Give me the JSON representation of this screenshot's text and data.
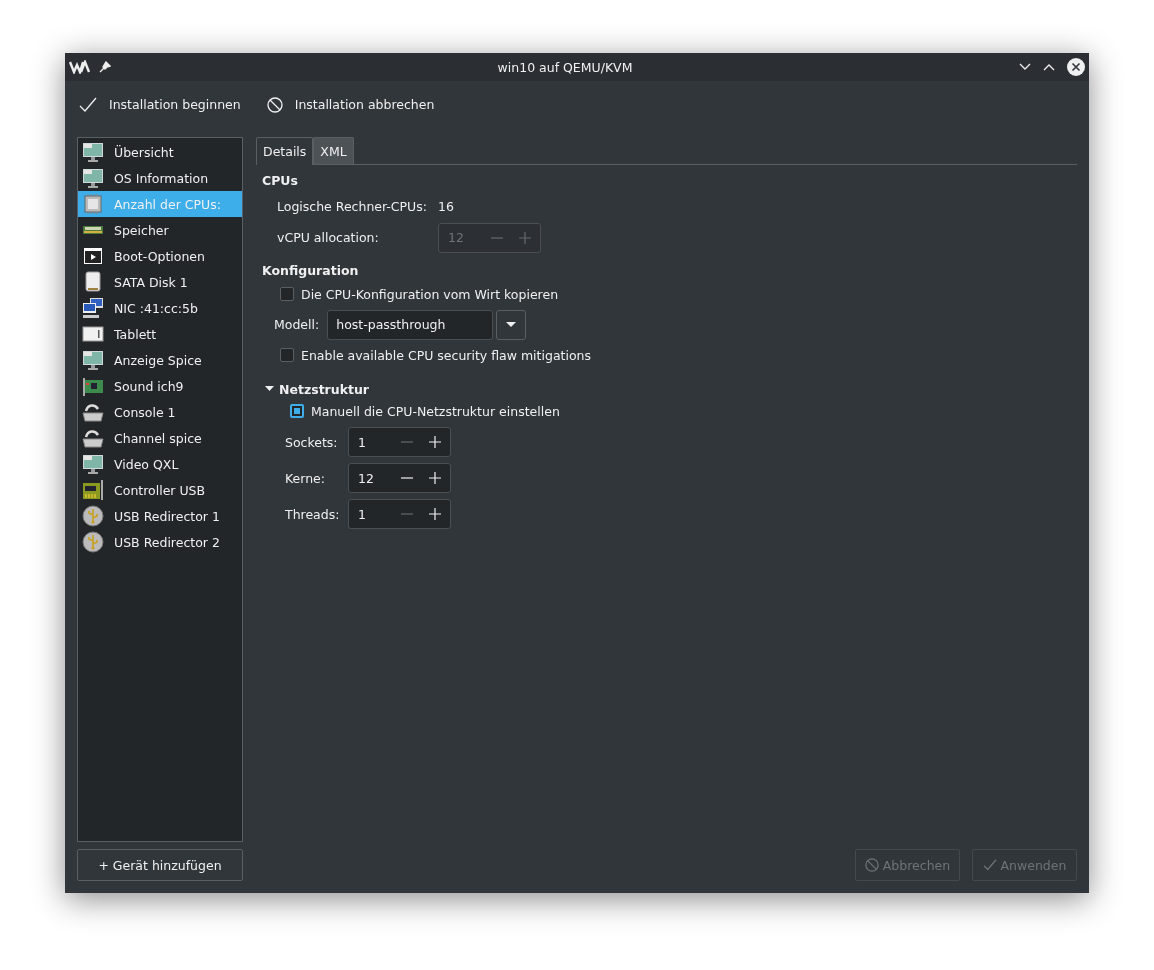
{
  "window": {
    "title": "win10 auf QEMU/KVM"
  },
  "toolbar": [
    {
      "kind": "check",
      "label": "Installation beginnen"
    },
    {
      "kind": "cancel",
      "label": "Installation abbrechen"
    }
  ],
  "sidebar": {
    "items": [
      {
        "kind": "display",
        "label": "Übersicht",
        "selected": false
      },
      {
        "kind": "display",
        "label": "OS Information",
        "selected": false
      },
      {
        "kind": "cpu",
        "label": "Anzahl der CPUs:",
        "selected": true
      },
      {
        "kind": "memory",
        "label": "Speicher",
        "selected": false
      },
      {
        "kind": "boot",
        "label": "Boot-Optionen",
        "selected": false
      },
      {
        "kind": "disk",
        "label": "SATA Disk 1",
        "selected": false
      },
      {
        "kind": "network",
        "label": "NIC :41:cc:5b",
        "selected": false
      },
      {
        "kind": "tablet",
        "label": "Tablett",
        "selected": false
      },
      {
        "kind": "display",
        "label": "Anzeige Spice",
        "selected": false
      },
      {
        "kind": "sound",
        "label": "Sound ich9",
        "selected": false
      },
      {
        "kind": "serial",
        "label": "Console 1",
        "selected": false
      },
      {
        "kind": "serial",
        "label": "Channel spice",
        "selected": false
      },
      {
        "kind": "display",
        "label": "Video QXL",
        "selected": false
      },
      {
        "kind": "controller",
        "label": "Controller USB",
        "selected": false
      },
      {
        "kind": "usb",
        "label": "USB Redirector 1",
        "selected": false
      },
      {
        "kind": "usb",
        "label": "USB Redirector 2",
        "selected": false
      }
    ],
    "add_button": {
      "label": "+ Gerät hinzufügen"
    }
  },
  "tabs": [
    {
      "label": "Details",
      "selected": true
    },
    {
      "label": "XML",
      "selected": false
    }
  ],
  "cpus": {
    "heading": "CPUs",
    "logical_label": "Logische Rechner-CPUs:",
    "logical_value": "16",
    "vcpu": {
      "label": "vCPU allocation:",
      "value": "12",
      "disabled": true
    }
  },
  "configuration": {
    "heading": "Konfiguration",
    "copy_host": {
      "label": "Die CPU-Konfiguration vom Wirt kopieren",
      "checked": false
    },
    "model_label": "Modell:",
    "model_value": "host-passthrough",
    "mitigations": {
      "label": "Enable available CPU security flaw mitigations",
      "checked": false
    }
  },
  "topology": {
    "heading": "Netzstruktur",
    "expanded": true,
    "manual": {
      "label": "Manuell die CPU-Netzstruktur einstellen",
      "checked": true
    },
    "fields": [
      {
        "label": "Sockets:",
        "value": "1",
        "minus_disabled": true
      },
      {
        "label": "Kerne:",
        "value": "12",
        "minus_disabled": false
      },
      {
        "label": "Threads:",
        "value": "1",
        "minus_disabled": true
      }
    ]
  },
  "buttons": [
    {
      "kind": "cancel",
      "label": "Abbrechen",
      "disabled": true
    },
    {
      "kind": "check",
      "label": "Anwenden",
      "disabled": true
    }
  ]
}
